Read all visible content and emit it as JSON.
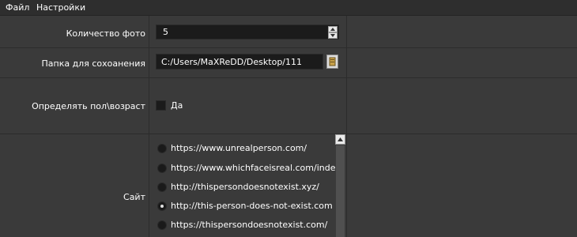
{
  "menubar": {
    "file": "Файл",
    "settings": "Настройки"
  },
  "photo_count": {
    "label": "Количество фото",
    "value": "5"
  },
  "save_folder": {
    "label": "Папка для сохоанения",
    "value": "C:/Users/MaXReDD/Desktop/111"
  },
  "gender_age": {
    "label": "Определять пол\\возраст",
    "checkbox_label": "Да",
    "checked": false
  },
  "site": {
    "label": "Сайт",
    "options": [
      {
        "label": "https://www.unrealperson.com/",
        "checked": false
      },
      {
        "label": "https://www.whichfaceisreal.com/index.php",
        "checked": false
      },
      {
        "label": "http://thispersondoesnotexist.xyz/",
        "checked": false
      },
      {
        "label": "http://this-person-does-not-exist.com",
        "checked": true
      },
      {
        "label": "https://thispersondoesnotexist.com/",
        "checked": false
      }
    ]
  },
  "icons": {
    "spin_up": "triangle-up-icon",
    "spin_down": "triangle-down-icon",
    "browse": "folder-icon",
    "scroll_up": "triangle-up-icon"
  },
  "colors": {
    "background": "#3a3a3a",
    "field": "#1b1b1b",
    "menubar": "#2e2e2e",
    "text": "#ffffff"
  }
}
